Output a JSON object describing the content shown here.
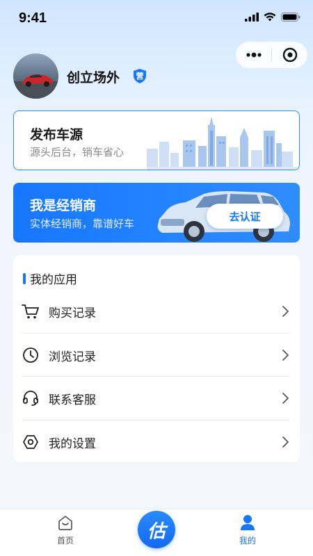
{
  "status_bar": {
    "time": "9:41"
  },
  "profile": {
    "name": "创立场外",
    "badge": "营"
  },
  "publish_card": {
    "title": "发布车源",
    "subtitle": "源头后台，销车省心"
  },
  "dealer_banner": {
    "title": "我是经销商",
    "subtitle": "实体经销商，靠谱好车",
    "button_label": "去认证"
  },
  "apps": {
    "title": "我的应用",
    "items": [
      {
        "label": "购买记录",
        "icon": "cart-icon"
      },
      {
        "label": "浏览记录",
        "icon": "clock-icon"
      },
      {
        "label": "联系客服",
        "icon": "headset-icon"
      },
      {
        "label": "我的设置",
        "icon": "settings-icon"
      }
    ]
  },
  "tab_bar": {
    "items": [
      {
        "label": "首页",
        "icon": "home-icon",
        "active": false
      },
      {
        "label": "估",
        "icon": "estimate-icon",
        "active": false
      },
      {
        "label": "我的",
        "icon": "user-icon",
        "active": true
      }
    ]
  },
  "colors": {
    "accent": "#1677ff",
    "text": "#1f1f1f",
    "muted": "#8a8a8a"
  }
}
